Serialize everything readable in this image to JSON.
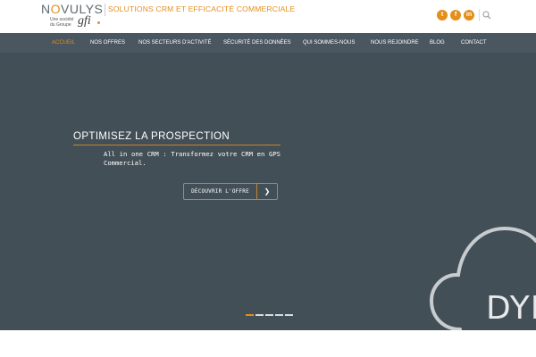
{
  "brand": {
    "name_prefix": "N",
    "name_o": "O",
    "name_suffix": "VULYS",
    "subline1": "Une société",
    "subline2": "du Groupe",
    "group_name": "gfi",
    "tagline": "SOLUTIONS CRM ET EFFICACITÉ COMMERCIALE",
    "accent_color": "#e38f1c"
  },
  "social": [
    {
      "name": "twitter-icon",
      "glyph": "t"
    },
    {
      "name": "facebook-icon",
      "glyph": "f"
    },
    {
      "name": "linkedin-icon",
      "glyph": "in"
    }
  ],
  "nav": {
    "items": [
      {
        "label": "ACCUEIL",
        "active": true
      },
      {
        "label": "NOS OFFRES"
      },
      {
        "label": "NOS SECTEURS D'ACTIVITÉ"
      },
      {
        "label": "SÉCURITÉ DES DONNÉES"
      },
      {
        "label": "QUI SOMMES-NOUS"
      },
      {
        "label": "NOUS REJOINDRE"
      },
      {
        "label": "BLOG"
      },
      {
        "label": "CONTACT"
      }
    ]
  },
  "hero": {
    "title": "OPTIMISEZ LA PROSPECTION",
    "text": "All in one CRM : Transformez votre CRM en GPS Commercial.",
    "cta_label": "DÉCOUVRIR L'OFFRE",
    "cta_arrow": "❯",
    "cloud_text": "DYN",
    "background_color": "#434f57",
    "slides_total": 5,
    "slide_active": 1
  }
}
